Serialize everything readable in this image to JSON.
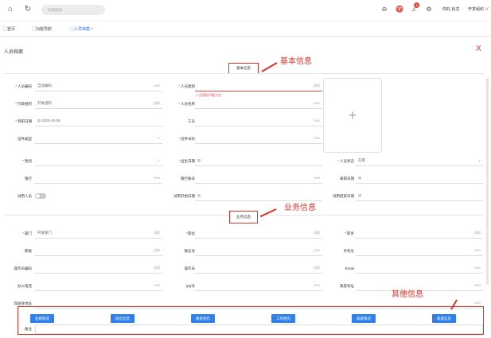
{
  "topbar": {
    "search_placeholder": "功能搜索",
    "greeting": "你好,肖龙",
    "org": "开发组织",
    "org_chevron": "∨",
    "notify_count": "3",
    "icons": [
      "home-icon",
      "refresh-icon",
      "zoom-icon",
      "shirt-icon",
      "bell-icon",
      "gear-icon"
    ]
  },
  "tabs": [
    {
      "label": "首页"
    },
    {
      "label": "功能导航"
    },
    {
      "label": "人员档案",
      "close": "×"
    }
  ],
  "page": {
    "title": "人员档案",
    "close": "X"
  },
  "sections": {
    "basic": "基本信息",
    "business": "业务信息",
    "other_annotation": "其他信息"
  },
  "annotations": {
    "basic": "基本信息",
    "business": "业务信息",
    "other": "其他信息"
  },
  "basic": {
    "person_code": {
      "label": "人员编码",
      "value": "自动编码",
      "count": "0/60"
    },
    "admin_org": {
      "label": "行政组织",
      "value": "开发组织",
      "action": "选取"
    },
    "join_date": {
      "label": "到职日期",
      "value": "2024-10-08"
    },
    "id_type": {
      "label": "证件类型"
    },
    "person_type": {
      "label": "人员类别",
      "action": "选取",
      "error": "人员类别不能为空"
    },
    "person_name": {
      "label": "人员名称",
      "count": "0/60"
    },
    "job_no": {
      "label": "工号",
      "count": "0/60"
    },
    "id_no": {
      "label": "证件号码",
      "count": "0/60"
    },
    "gender": {
      "label": "性别"
    },
    "bank": {
      "label": "银行",
      "count": "0/60"
    },
    "trial_person": {
      "label": "试用人员"
    },
    "birth_date": {
      "label": "出生日期"
    },
    "bank_account": {
      "label": "银行账号",
      "count": "0/60"
    },
    "trial_start": {
      "label": "试用开始日期"
    },
    "person_status": {
      "label": "人员状态",
      "value": "在职"
    },
    "leave_date": {
      "label": "离职日期"
    },
    "trial_end": {
      "label": "试用结束日期"
    },
    "upload_plus": "+"
  },
  "business": {
    "dept": {
      "label": "部门",
      "value": "开发部门",
      "action": "选取"
    },
    "rank": {
      "label": "职级",
      "action": "选取"
    },
    "operator_code": {
      "label": "操作员编码",
      "action": "选取"
    },
    "office_phone": {
      "label": "办公电话",
      "count": "0/60"
    },
    "position": {
      "label": "职位",
      "action": "选取"
    },
    "wechat": {
      "label": "微信号",
      "count": "0/60"
    },
    "operator": {
      "label": "操作员",
      "action": "选取"
    },
    "qq": {
      "label": "QQ号",
      "count": "0/60"
    },
    "duty": {
      "label": "职务",
      "action": "选取"
    },
    "mobile": {
      "label": "手机号",
      "count": "0/60"
    },
    "email": {
      "label": "Email",
      "count": "0/60"
    },
    "home_address": {
      "label": "家庭地址",
      "count": "0/60"
    },
    "current_address": {
      "label": "现居住地址",
      "count": "0/60"
    },
    "remark": {
      "label": "备注"
    }
  },
  "other_buttons": [
    "任职情况",
    "岗位信息",
    "教育经历",
    "工作经历",
    "家庭情况",
    "家庭信息"
  ]
}
